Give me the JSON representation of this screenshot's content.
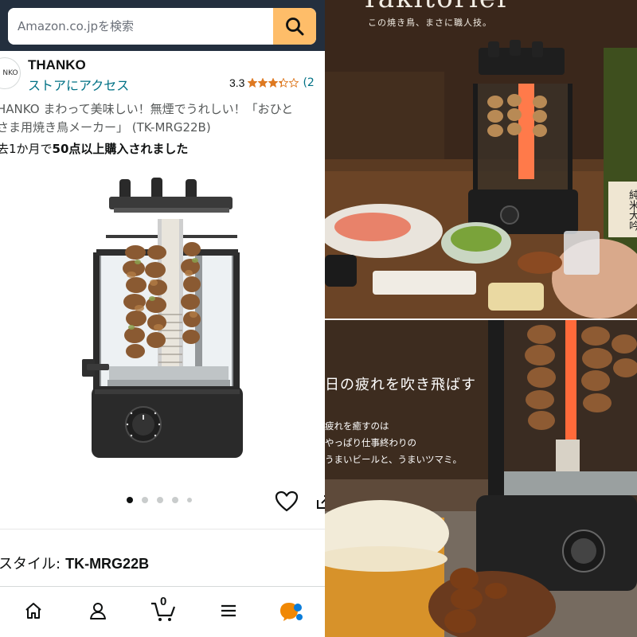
{
  "search": {
    "placeholder": "Amazon.co.jpを検索"
  },
  "store": {
    "logo_text": "NKO",
    "brand": "THANKO",
    "store_link": "ストアにアクセス",
    "rating": "3.3",
    "rating_value": 3.3,
    "review_count": "(2"
  },
  "product": {
    "title_line1": "HANKO まわって美味しい！無煙でうれしい！「おひと",
    "title_line2": "さま用焼き鳥メーカー」 (TK-MRG22B)",
    "bought_prefix": "去1か月で",
    "bought_bold": "50点以上購入されました",
    "image_icon": "yakitori-grill-product-image",
    "carousel": {
      "count": 5,
      "active": 0
    }
  },
  "style": {
    "label": "スタイル:",
    "value": "TK-MRG22B"
  },
  "nav": {
    "cart_count": "0",
    "items": [
      "home-icon",
      "user-icon",
      "cart-icon",
      "menu-icon",
      "rufus-icon"
    ]
  },
  "photos": {
    "top": {
      "brand_script": "Yakitorier",
      "caption": "この焼き鳥、まさに職人技。",
      "sake_label": "純米大吟"
    },
    "bottom": {
      "headline": "日の疲れを吹き飛ばす",
      "subcopy": [
        "疲れを癒すのは",
        "やっぱり仕事終わりの",
        "うまいビールと、うまいツマミ。"
      ]
    }
  },
  "colors": {
    "header_bg": "#232f3e",
    "search_button": "#febd69",
    "link": "#007185",
    "star": "#de7921",
    "rufus": "#f08804"
  }
}
